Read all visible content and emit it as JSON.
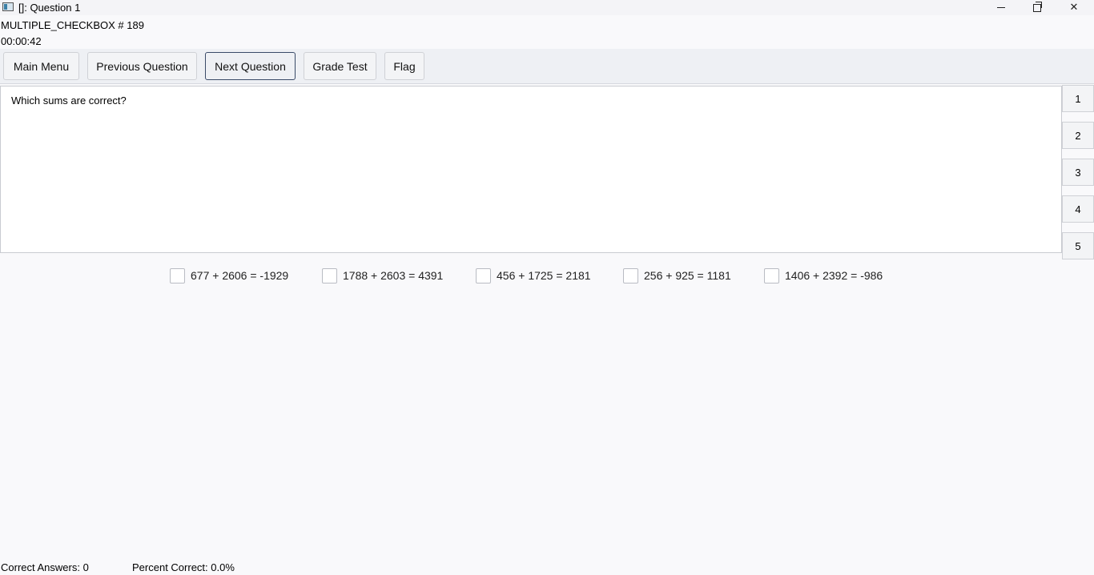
{
  "window": {
    "title": "[]: Question 1",
    "controls": {
      "minimize_icon": "minimize-icon",
      "maximize_icon": "restore-icon",
      "close_label": "✕"
    }
  },
  "header": {
    "question_type": "MULTIPLE_CHECKBOX # 189",
    "timer": "00:00:42"
  },
  "toolbar": {
    "main_menu": "Main Menu",
    "previous": "Previous Question",
    "next": "Next Question",
    "grade": "Grade Test",
    "flag": "Flag"
  },
  "question": {
    "text": "Which sums are correct?"
  },
  "question_nav": [
    "1",
    "2",
    "3",
    "4",
    "5"
  ],
  "answers": [
    "677 + 2606 = -1929",
    "1788 + 2603 = 4391",
    "456 + 1725 = 2181",
    "256 + 925 = 1181",
    "1406 + 2392 = -986"
  ],
  "status": {
    "correct": "Correct Answers: 0",
    "percent": "Percent Correct: 0.0%"
  }
}
